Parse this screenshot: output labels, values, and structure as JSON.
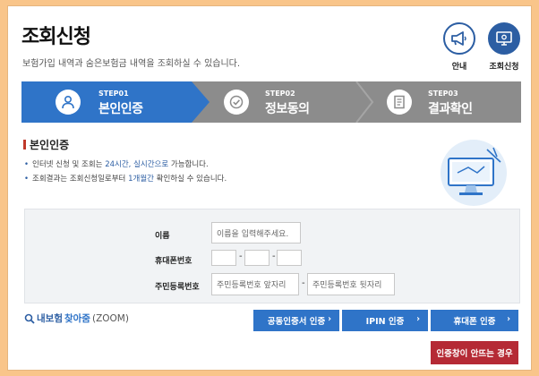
{
  "header": {
    "title": "조회신청",
    "subtitle": "보험가입 내역과 숨은보험금 내역을 조회하실 수 있습니다.",
    "guide_label": "안내",
    "request_label": "조회신청"
  },
  "steps": [
    {
      "num": "STEP01",
      "name": "본인인증",
      "active": true
    },
    {
      "num": "STEP02",
      "name": "정보동의",
      "active": false
    },
    {
      "num": "STEP03",
      "name": "결과확인",
      "active": false
    }
  ],
  "section": {
    "heading": "본인인증",
    "note1_pre": "인터넷 신청 및 조회는 ",
    "note1_hl": "24시간, 실시간으로",
    "note1_post": " 가능합니다.",
    "note2_pre": "조회결과는 조회신청일로부터 ",
    "note2_hl": "1개월간",
    "note2_post": " 확인하실 수 있습니다."
  },
  "form": {
    "name_label": "이름",
    "name_placeholder": "이름을 입력해주세요.",
    "phone_label": "휴대폰번호",
    "phone_sep": "-",
    "rrn_label": "주민등록번호",
    "rrn_front_placeholder": "주민등록번호 앞자리",
    "rrn_sep": "-",
    "rrn_back_placeholder": "주민등록번호 뒷자리"
  },
  "zoom": {
    "part1": "내보험",
    "part2": "찾아줌",
    "part3": "(ZOOM)"
  },
  "buttons": {
    "cert": "공동인증서 인증",
    "ipin": "IPIN 인증",
    "phone": "휴대폰 인증",
    "popup_help": "인증창이 안뜨는 경우",
    "arrow": "›"
  },
  "colors": {
    "primary": "#2f74c8",
    "navy": "#2c5ea3",
    "danger": "#b52a35",
    "step_inactive": "#8c8c8c"
  }
}
